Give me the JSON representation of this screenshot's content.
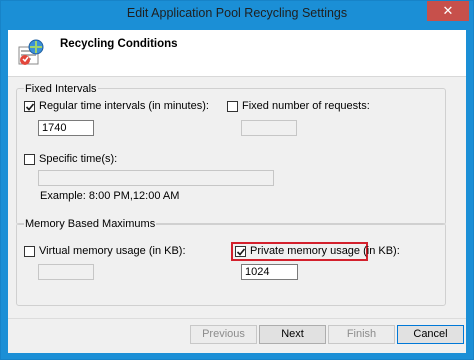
{
  "window": {
    "title": "Edit Application Pool Recycling Settings",
    "close_glyph": "✕"
  },
  "header": {
    "title": "Recycling Conditions",
    "icon": "recycling-wizard-icon"
  },
  "fixed_intervals": {
    "group_label": "Fixed Intervals",
    "regular_time": {
      "label": "Regular time intervals (in minutes):",
      "checked": true,
      "value": "1740"
    },
    "fixed_requests": {
      "label": "Fixed number of requests:",
      "checked": false,
      "value": ""
    },
    "specific_times": {
      "label": "Specific time(s):",
      "checked": false,
      "value": "",
      "example": "Example: 8:00 PM,12:00 AM"
    }
  },
  "memory": {
    "group_label": "Memory Based Maximums",
    "virtual_memory": {
      "label": "Virtual memory usage (in KB):",
      "checked": false,
      "value": ""
    },
    "private_memory": {
      "label": "Private memory usage (in KB):",
      "checked": true,
      "value": "1024"
    }
  },
  "buttons": {
    "previous": "Previous",
    "next": "Next",
    "finish": "Finish",
    "cancel": "Cancel"
  },
  "colors": {
    "title_bar": "#1b8fd6",
    "close_button": "#c7504b",
    "highlight": "#d3202c"
  }
}
